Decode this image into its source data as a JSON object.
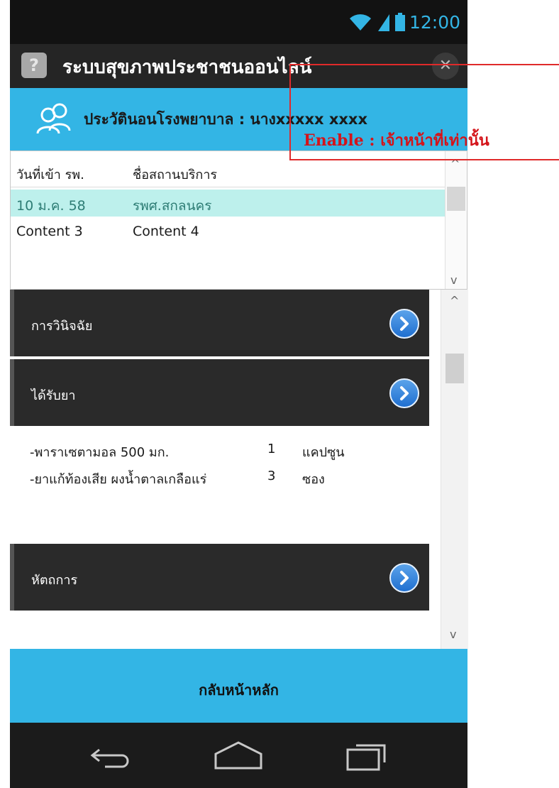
{
  "status_bar": {
    "time": "12:00"
  },
  "app": {
    "title": "ระบบสุขภาพประชาชนออนไลน์"
  },
  "header": {
    "title": "ประวัตินอนโรงพยาบาล : นางxxxxx  xxxx"
  },
  "table": {
    "columns": [
      "วันที่เข้า รพ.",
      "ชื่อสถานบริการ"
    ],
    "rows": [
      [
        "10 ม.ค. 58",
        "รพศ.สกลนคร"
      ],
      [
        "Content 3",
        "Content 4"
      ]
    ]
  },
  "sections": {
    "diagnosis": "การวินิจฉัย",
    "medication": "ได้รับยา",
    "procedure": "หัตถการ"
  },
  "medications": [
    {
      "name": "-พาราเซตามอล 500 มก.",
      "qty": "1",
      "unit": "แคปซูน"
    },
    {
      "name": "-ยาแก้ท้องเสีย ผงน้ำตาลเกลือแร่",
      "qty": "3",
      "unit": "ซอง"
    }
  ],
  "home_button": "กลับหน้าหลัก",
  "annotation": "Enable : เจ้าหน้าที่เท่านั้น",
  "colors": {
    "accent": "#33b5e5",
    "annotation": "#d4141a",
    "highlight_row": "#bdf0ec"
  }
}
